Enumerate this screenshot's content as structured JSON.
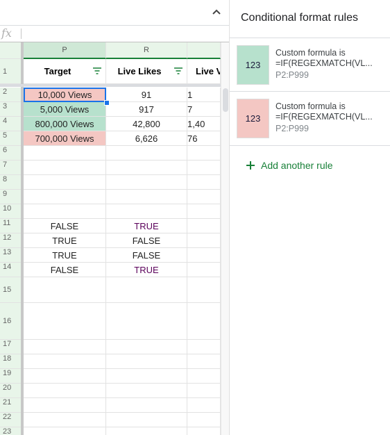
{
  "formula_bar": {
    "fx_label": "fx"
  },
  "columns": [
    {
      "letter": "P",
      "header": "Target"
    },
    {
      "letter": "R",
      "header": "Live Likes"
    },
    {
      "letter": "",
      "header": "Live V"
    }
  ],
  "rows": [
    {
      "num": "2",
      "cells": [
        "10,000 Views",
        "91",
        "1"
      ]
    },
    {
      "num": "3",
      "cells": [
        "5,000 Views",
        "917",
        "7"
      ]
    },
    {
      "num": "4",
      "cells": [
        "800,000 Views",
        "42,800",
        "1,40"
      ]
    },
    {
      "num": "5",
      "cells": [
        "700,000 Views",
        "6,626",
        "76"
      ]
    },
    {
      "num": "6",
      "cells": [
        "",
        "",
        ""
      ]
    },
    {
      "num": "7",
      "cells": [
        "",
        "",
        ""
      ]
    },
    {
      "num": "8",
      "cells": [
        "",
        "",
        ""
      ]
    },
    {
      "num": "9",
      "cells": [
        "",
        "",
        ""
      ]
    },
    {
      "num": "10",
      "cells": [
        "",
        "",
        ""
      ]
    },
    {
      "num": "11",
      "cells": [
        "FALSE",
        "TRUE",
        ""
      ]
    },
    {
      "num": "12",
      "cells": [
        "TRUE",
        "FALSE",
        ""
      ]
    },
    {
      "num": "13",
      "cells": [
        "TRUE",
        "FALSE",
        ""
      ]
    },
    {
      "num": "14",
      "cells": [
        "FALSE",
        "TRUE",
        ""
      ]
    },
    {
      "num": "15",
      "cells": [
        "",
        "",
        ""
      ]
    },
    {
      "num": "16",
      "cells": [
        "",
        "",
        ""
      ]
    },
    {
      "num": "17",
      "cells": [
        "",
        "",
        ""
      ]
    },
    {
      "num": "18",
      "cells": [
        "",
        "",
        ""
      ]
    },
    {
      "num": "19",
      "cells": [
        "",
        "",
        ""
      ]
    },
    {
      "num": "20",
      "cells": [
        "",
        "",
        ""
      ]
    },
    {
      "num": "21",
      "cells": [
        "",
        "",
        ""
      ]
    },
    {
      "num": "22",
      "cells": [
        "",
        "",
        ""
      ]
    },
    {
      "num": "23",
      "cells": [
        "",
        "",
        ""
      ]
    }
  ],
  "header_row_num": "1",
  "cell_fills": {
    "2": "#f4c7c3",
    "3": "#b7e1cd",
    "4": "#b7e1cd",
    "5": "#f4c7c3"
  },
  "colors": {
    "green_fill": "#b7e1cd",
    "red_fill": "#f4c7c3",
    "accent": "#188038",
    "selection": "#1a73e8"
  },
  "panel": {
    "title": "Conditional format rules",
    "rules": [
      {
        "preview": "123",
        "line1": "Custom formula is",
        "line2": "=IF(REGEXMATCH(VL...",
        "range": "P2:P999",
        "fill": "#b7e1cd"
      },
      {
        "preview": "123",
        "line1": "Custom formula is",
        "line2": "=IF(REGEXMATCH(VL...",
        "range": "P2:P999",
        "fill": "#f4c7c3"
      }
    ],
    "add_rule": "Add another rule"
  }
}
